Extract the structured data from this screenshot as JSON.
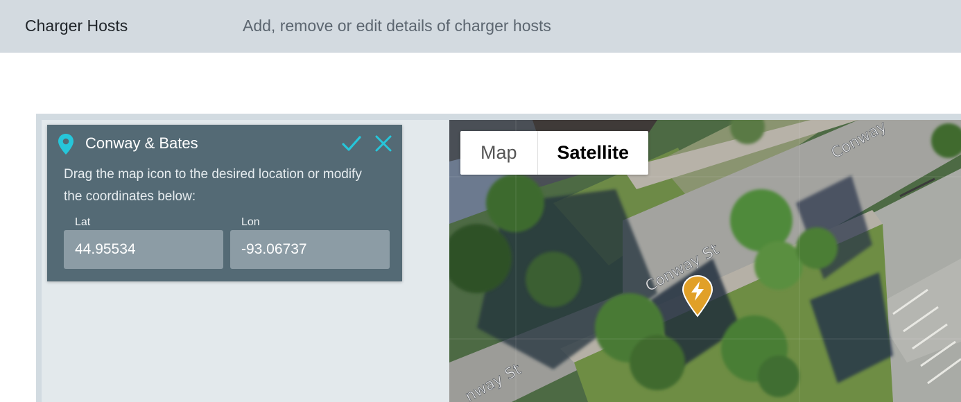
{
  "header": {
    "title": "Charger Hosts",
    "subtitle": "Add, remove or edit details of charger hosts"
  },
  "panel": {
    "location_name": "Conway & Bates",
    "instructions": "Drag the map icon to the desired location or modify the coordinates below:",
    "lat_label": "Lat",
    "lat_value": "44.95534",
    "lon_label": "Lon",
    "lon_value": "-93.06737",
    "icons": {
      "pin": "map-pin-icon",
      "confirm": "check-icon",
      "cancel": "close-icon"
    }
  },
  "map": {
    "view_toggle": {
      "map_label": "Map",
      "satellite_label": "Satellite",
      "selected": "Satellite"
    },
    "street_labels": [
      "Conway St",
      "Conway",
      "nway St"
    ],
    "marker_icon": "lightning-marker-icon"
  },
  "colors": {
    "header_bg": "#d3dae0",
    "panel_bg": "#546a75",
    "accent": "#26c6da",
    "marker": "#e1a028"
  }
}
